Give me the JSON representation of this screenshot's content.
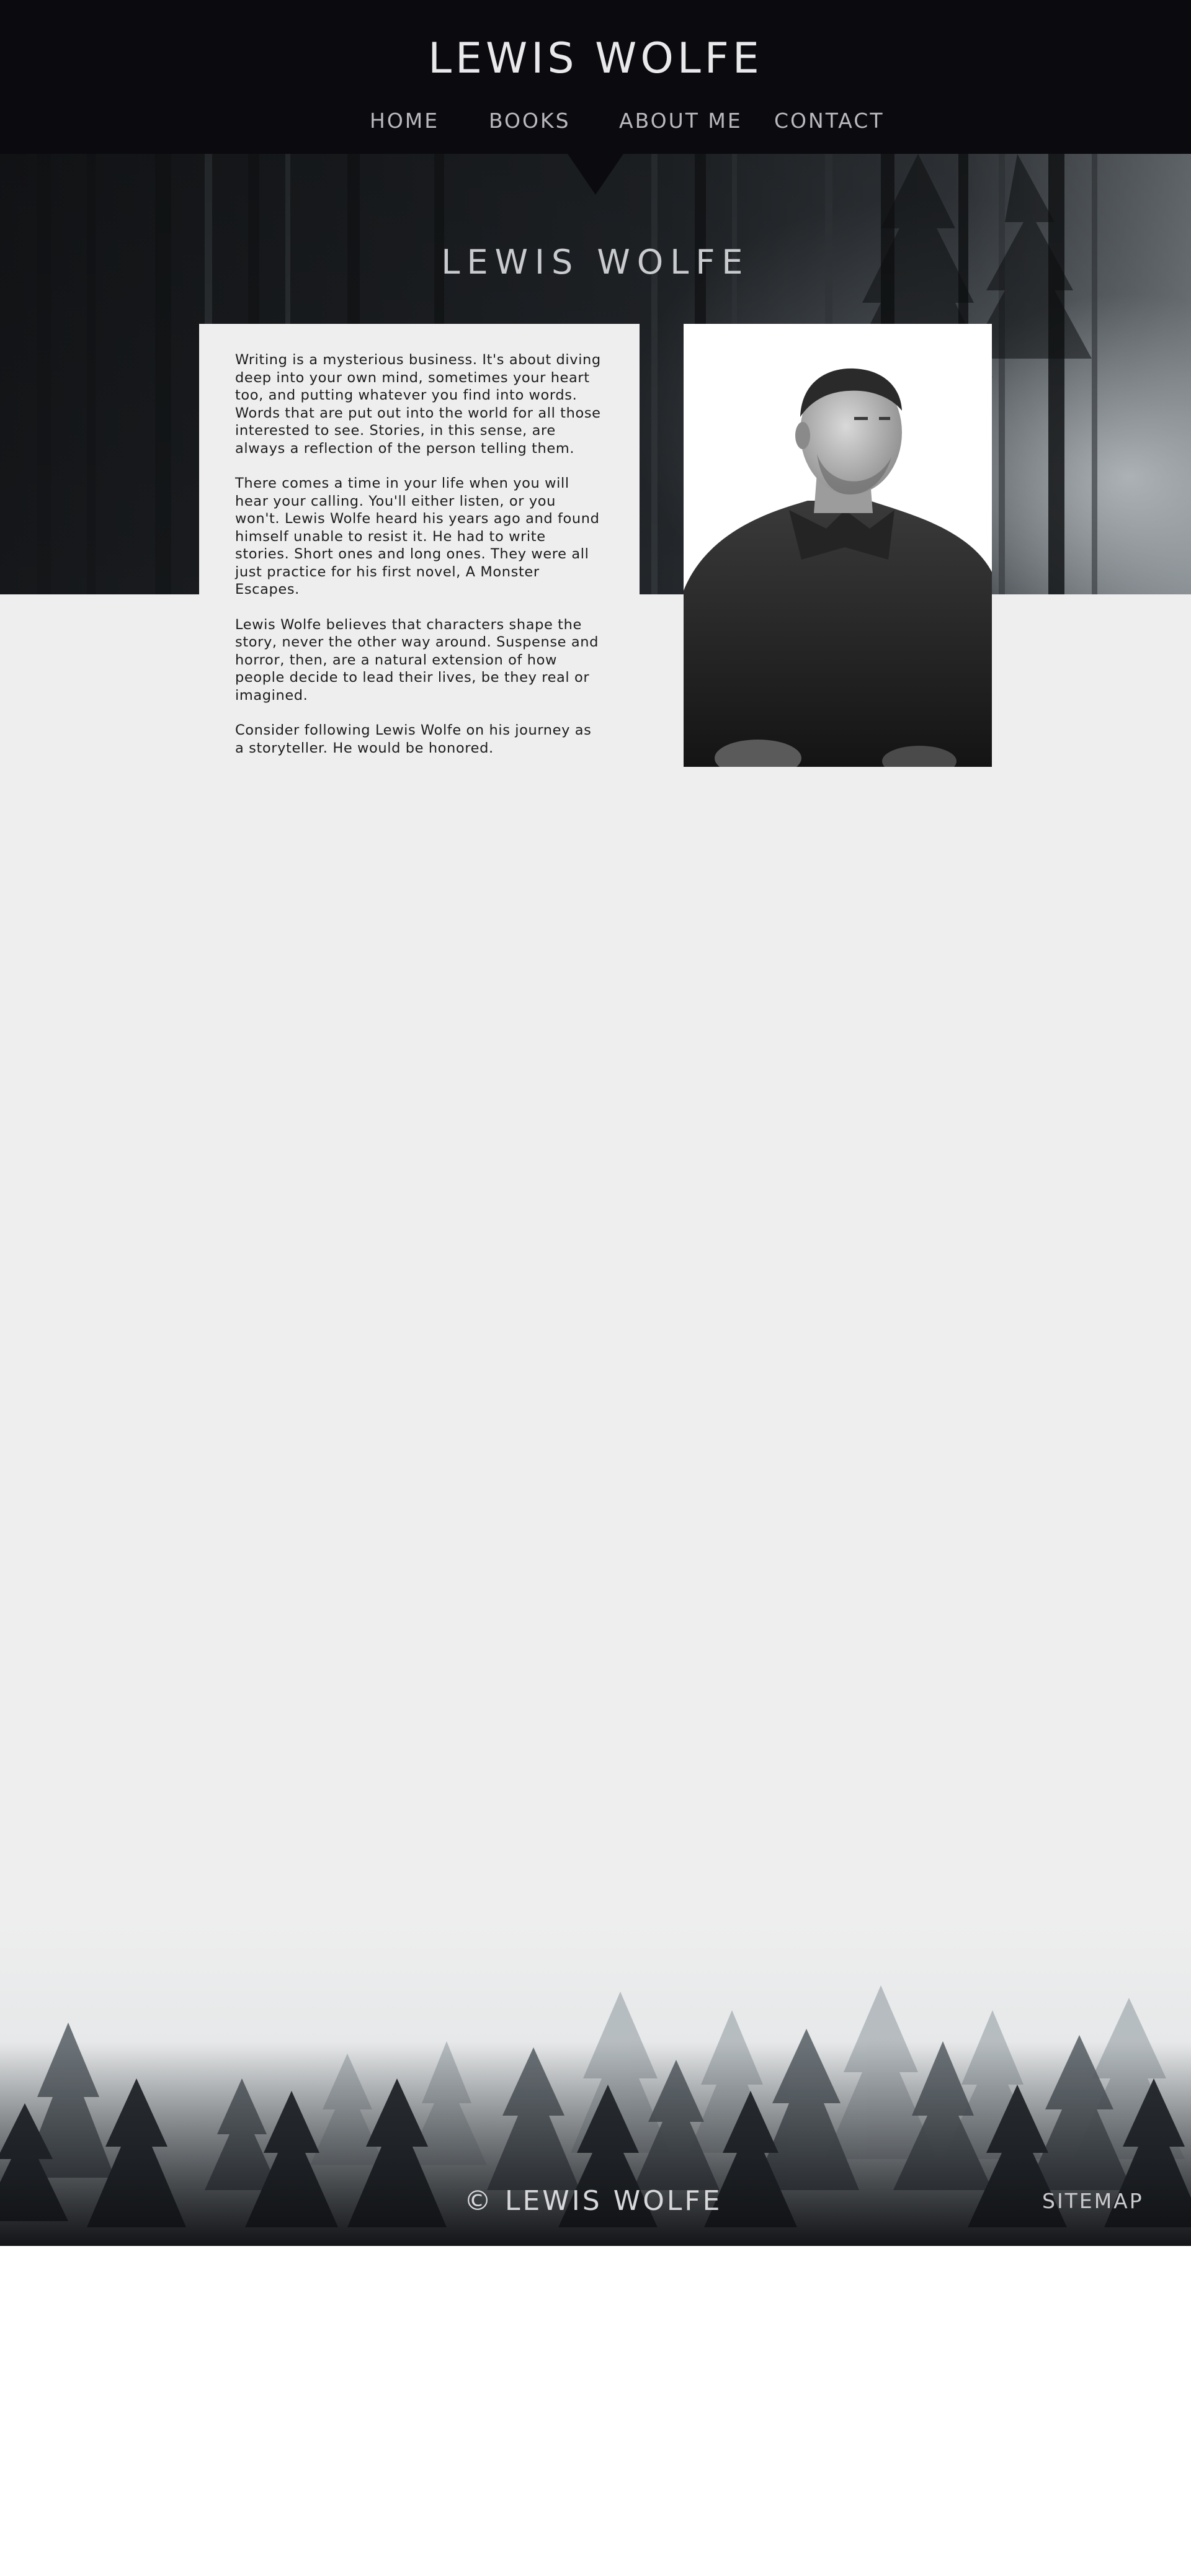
{
  "header": {
    "site_title": "LEWIS WOLFE",
    "nav": [
      {
        "label": "HOME"
      },
      {
        "label": "BOOKS"
      },
      {
        "label": "ABOUT ME"
      },
      {
        "label": "CONTACT"
      }
    ],
    "background_color": "#0b0b0f"
  },
  "hero": {
    "title": "LEWIS WOLFE",
    "image": "misty-forest-banner"
  },
  "about": {
    "paragraphs": [
      "Writing is a mysterious business. It's about diving deep into your own mind, sometimes your heart too, and putting whatever you find into words. Words that are put out into the world for all those interested to see. Stories, in this sense, are always a reflection of the person telling them.",
      "There comes a time in your life when you will hear your calling. You'll either listen, or you won't. Lewis Wolfe heard his years ago and found himself unable to resist it. He had to write stories. Short ones and long ones. They were all just practice for his first novel, A Monster Escapes.",
      "Lewis Wolfe believes that characters shape the story, never the other way around. Suspense and horror, then, are a natural extension of how people decide to lead their lives, be they real or imagined.",
      "Consider following Lewis Wolfe on his journey as a storyteller. He would be honored."
    ],
    "photo": "author-portrait-black-and-white",
    "background_color": "#eeeeee"
  },
  "footer": {
    "copyright": "© LEWIS WOLFE",
    "sitemap_label": "SITEMAP",
    "image": "misty-pine-forest"
  }
}
